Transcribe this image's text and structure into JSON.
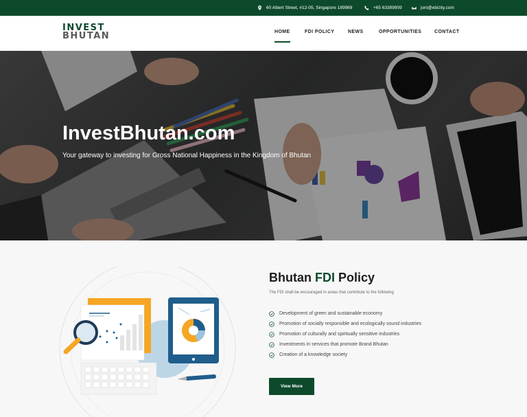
{
  "topbar": {
    "address": "60 Albert Street, #12-05, Singapore 189969",
    "phone": "+65 63389909",
    "email": "joni@ebizity.com"
  },
  "logo": {
    "line1": "INVEST",
    "line2": "BHUTAN"
  },
  "nav": {
    "items": [
      {
        "label": "HOME",
        "active": true
      },
      {
        "label": "FDI POLICY"
      },
      {
        "label": "NEWS"
      },
      {
        "label": "OPPORTUNITIES"
      },
      {
        "label": "CONTACT"
      }
    ]
  },
  "hero": {
    "title": "InvestBhutan.com",
    "subtitle": "Your gateway to investing for Gross National Happiness in the Kingdom of Bhutan"
  },
  "policy": {
    "title_prefix": "Bhutan ",
    "title_accent": "FDI",
    "title_suffix": " Policy",
    "intro": "The FDI shall be encouraged in areas that contribute to the following",
    "items": [
      "Development of green and sustainable economy",
      "Promotion of socially responsible and ecologically sound industries",
      "Promotion of culturally and spiritually sensitive industries",
      "Investments in services that promote Brand Bhutan",
      "Creation of a knowledge society"
    ],
    "button_label": "View More"
  },
  "colors": {
    "brand_green": "#0d4a2c",
    "accent_orange": "#f5a623",
    "accent_blue": "#1f5d8c"
  }
}
